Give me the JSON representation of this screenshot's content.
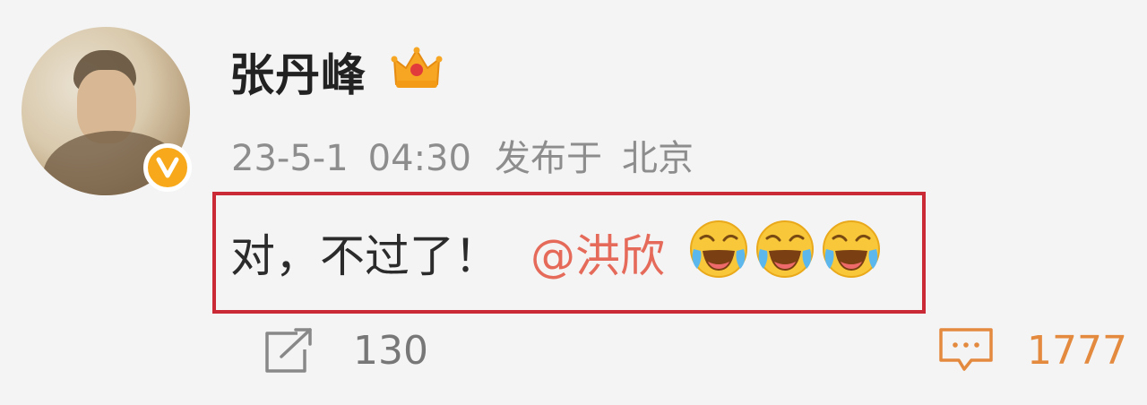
{
  "author": {
    "name": "张丹峰"
  },
  "post": {
    "date": "23-5-1",
    "time": "04:30",
    "published_label": "发布于",
    "location": "北京",
    "text": "对，不过了！",
    "mention": "@洪欣",
    "emojis": [
      "laugh-cry-emoji",
      "laugh-cry-emoji",
      "laugh-cry-emoji"
    ]
  },
  "actions": {
    "repost_count": "130",
    "comment_count": "1777"
  },
  "colors": {
    "highlight_border": "#c92a35",
    "mention": "#e56a5a",
    "comment": "#e38a3e",
    "verified_badge": "#f7a91b"
  }
}
